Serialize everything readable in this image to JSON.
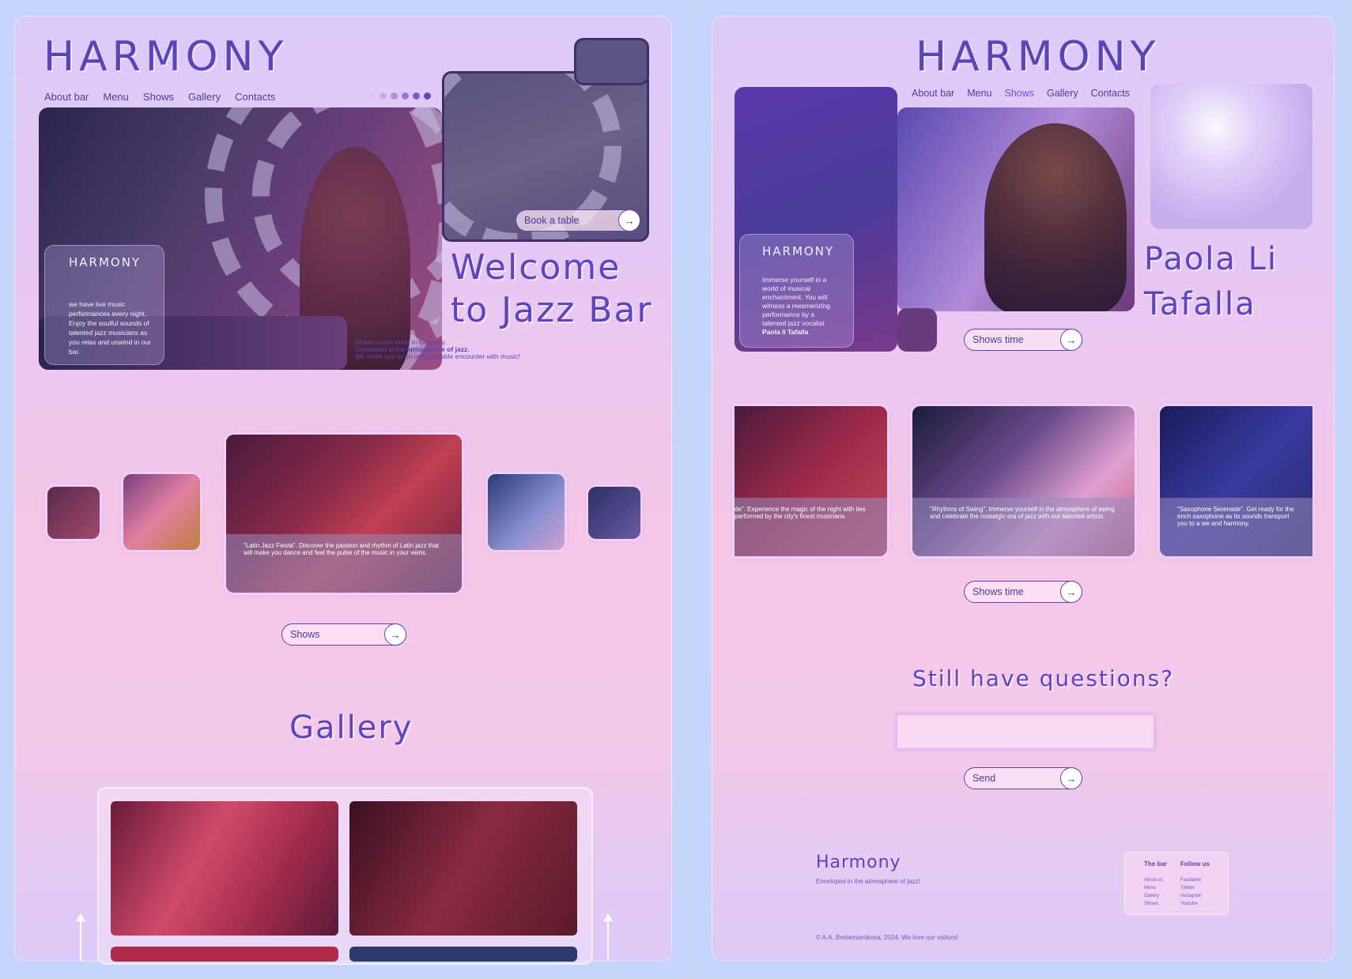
{
  "left": {
    "logo": "HARMONY",
    "nav": [
      "About bar",
      "Menu",
      "Shows",
      "Gallery",
      "Contacts"
    ],
    "book_button": "Book a table",
    "hero_card": {
      "title": "HARMONY",
      "text": "we have live music performances every night. Enjoy the soulful sounds of talented jazz musicians as you relax and unwind in our bar."
    },
    "welcome_line1": "Welcome",
    "welcome_line2": "to Jazz Bar",
    "tagline_1": "Where notes meet in harmony.",
    "tagline_2a": "Enveloped in the ",
    "tagline_2b": "atmosphere of jazz.",
    "tagline_3": "We invite you to an unforgettable encounter with music!",
    "carousel_caption": "\"Latin Jazz Fiesta\". Discover the passion and rhythm of Latin jazz that will make you dance and feel the pulse of the music in your veins.",
    "shows_button": "Shows",
    "gallery_title": "Gallery"
  },
  "right": {
    "logo": "HARMONY",
    "nav": [
      "About bar",
      "Menu",
      "Shows",
      "Gallery",
      "Contacts"
    ],
    "active_nav": "Shows",
    "hero_card": {
      "title": "HARMONY",
      "text": "Immerse yourself in a world of musical enchantment. You will witness a mesmerizing performance by a talented jazz vocalist",
      "name": "Paola li Tafalla"
    },
    "artist_line1": "Paola Li",
    "artist_line2": "Tafalla",
    "shows_time_button": "Shows time",
    "captions": [
      "de\". Experience the magic of the night with lies performed by the city's finest musicians.",
      "\"Rhythms of Swing\". Immerse yourself in the atmosphere of swing and celebrate the nostalgic era of jazz with our talented artists.",
      "\"Saxophone Serenade\". Get ready for the ench saxophone as its sounds transport you to a we and harmony."
    ],
    "shows_time_button_2": "Shows time",
    "questions_title": "Still have questions?",
    "send_button": "Send",
    "footer": {
      "brand": "Harmony",
      "slogan": "Enveloped in the atmosphere of jazz!",
      "col1_title": "The bar",
      "col1_items": [
        "About us",
        "Menu",
        "Gallery",
        "Shows"
      ],
      "col2_title": "Follow us",
      "col2_items": [
        "Facebook",
        "Twitter",
        "Instagram",
        "Youtube"
      ],
      "copyright": "© A.A. Bestemianikova, 2024. We love our visitors!"
    }
  },
  "colors": {
    "accent": "#5a45b8",
    "bg_top": "#dccbfb",
    "bg_mid": "#f6c7e8",
    "frame": "#c5d5fb"
  }
}
